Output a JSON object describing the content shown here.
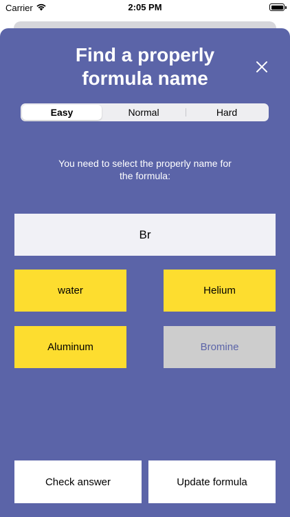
{
  "status_bar": {
    "carrier": "Carrier",
    "time": "2:05 PM",
    "wifi_icon": "wifi-icon",
    "battery_icon": "battery-full-icon"
  },
  "modal": {
    "title_line1": "Find a properly",
    "title_line2": "formula name",
    "close_icon": "close-icon",
    "background_color": "#5b64a8"
  },
  "difficulty": {
    "options": [
      "Easy",
      "Normal",
      "Hard"
    ],
    "selected": "Easy"
  },
  "question": {
    "instruction_line1": "You need to select the properly name for",
    "instruction_line2": "the formula:",
    "formula": "Br"
  },
  "answers": [
    {
      "label": "water",
      "state": "default",
      "color": "#fddd2f"
    },
    {
      "label": "Helium",
      "state": "default",
      "color": "#fddd2f"
    },
    {
      "label": "Aluminum",
      "state": "default",
      "color": "#fddd2f"
    },
    {
      "label": "Bromine",
      "state": "disabled",
      "color": "#cdcdcd"
    }
  ],
  "actions": {
    "check_label": "Check answer",
    "update_label": "Update formula"
  }
}
